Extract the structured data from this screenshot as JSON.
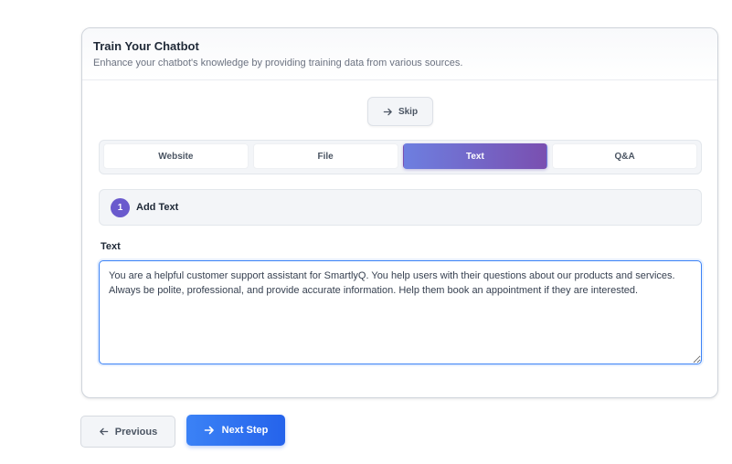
{
  "card": {
    "title": "Train Your Chatbot",
    "subtitle": "Enhance your chatbot's knowledge by providing training data from various sources."
  },
  "skip": {
    "label": "Skip",
    "icon": "arrow-right-icon"
  },
  "tabs": [
    {
      "label": "Website",
      "active": false
    },
    {
      "label": "File",
      "active": false
    },
    {
      "label": "Text",
      "active": true
    },
    {
      "label": "Q&A",
      "active": false
    }
  ],
  "step": {
    "number": "1",
    "label": "Add Text"
  },
  "text_field": {
    "label": "Text",
    "value": "You are a helpful customer support assistant for SmartlyQ. You help users with their questions about our products and services. Always be polite, professional, and provide accurate information. Help them book an appointment if they are interested."
  },
  "footer": {
    "previous_label": "Previous",
    "previous_icon": "arrow-left-icon",
    "next_label": "Next Step",
    "next_icon": "arrow-right-icon"
  },
  "colors": {
    "accent_blue": "#2563eb",
    "tab_active_start": "#6d7fe0",
    "tab_active_end": "#7a4fb0",
    "step_badge": "#6a5acd"
  }
}
